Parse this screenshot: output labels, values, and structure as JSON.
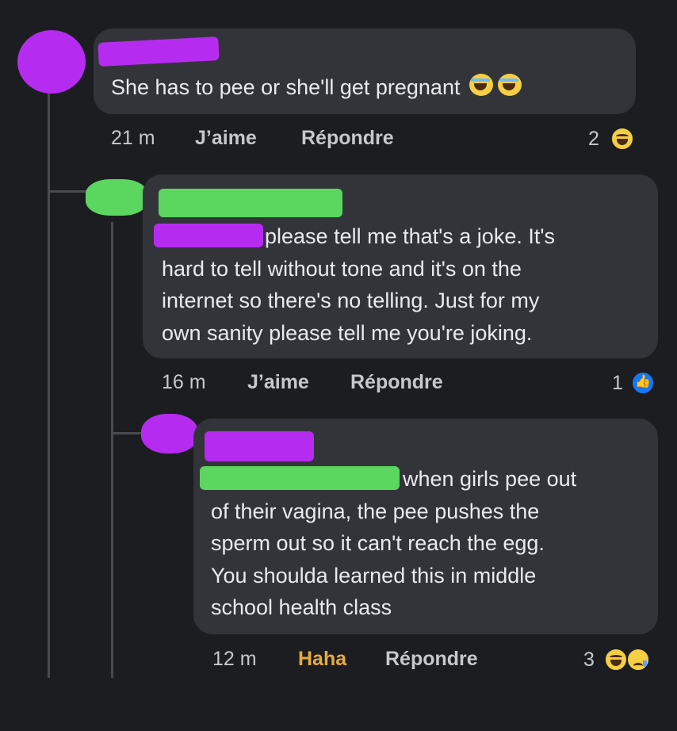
{
  "comments": [
    {
      "text": "She has to pee or she'll get pregnant",
      "time": "21 m",
      "like_label": "J’aime",
      "reply_label": "Répondre",
      "reaction_count": "2",
      "reactions": [
        "laugh-emoji"
      ],
      "inline_emojis": [
        "laughing-crying-emoji",
        "laughing-crying-emoji"
      ]
    },
    {
      "text_lines": [
        "please tell me that's a joke. It's",
        "hard to tell without tone and it's on the",
        "internet so there's no telling. Just for my",
        "own sanity please tell me you're joking."
      ],
      "time": "16 m",
      "like_label": "J’aime",
      "reply_label": "Répondre",
      "reaction_count": "1",
      "reactions": [
        "like-icon"
      ]
    },
    {
      "text_lines": [
        "when girls pee out",
        "of their vagina, the pee pushes the",
        "sperm out so it can't reach the egg.",
        "You shoulda learned this in middle",
        "school health class"
      ],
      "time": "12 m",
      "like_label": "Haha",
      "reply_label": "Répondre",
      "reaction_count": "3",
      "reactions": [
        "laugh-emoji",
        "sad-emoji"
      ],
      "accent_color": "#e6ac41"
    }
  ]
}
